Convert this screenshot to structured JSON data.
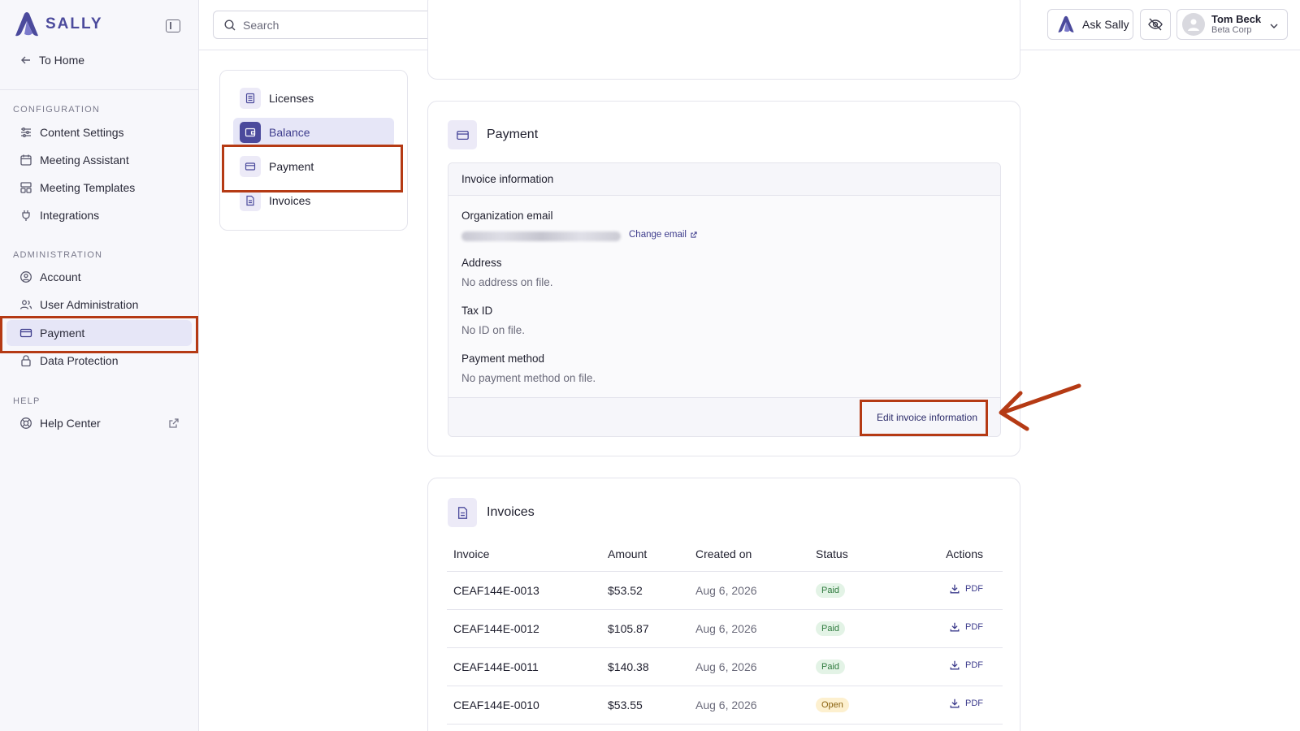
{
  "brand": {
    "name": "SALLY",
    "logo_icon": "sally-logo-icon"
  },
  "sidebar": {
    "back_label": "To Home",
    "sections": [
      {
        "title": "CONFIGURATION",
        "items": [
          {
            "label": "Content Settings",
            "icon": "sliders-icon"
          },
          {
            "label": "Meeting Assistant",
            "icon": "calendar-icon"
          },
          {
            "label": "Meeting Templates",
            "icon": "template-icon"
          },
          {
            "label": "Integrations",
            "icon": "plug-icon"
          }
        ]
      },
      {
        "title": "ADMINISTRATION",
        "items": [
          {
            "label": "Account",
            "icon": "user-circle-icon"
          },
          {
            "label": "User Administration",
            "icon": "users-icon"
          },
          {
            "label": "Payment",
            "icon": "credit-card-icon",
            "active": true
          },
          {
            "label": "Data Protection",
            "icon": "lock-icon"
          }
        ]
      },
      {
        "title": "HELP",
        "items": [
          {
            "label": "Help Center",
            "icon": "lifebuoy-icon",
            "external": true
          }
        ]
      }
    ]
  },
  "topbar": {
    "search_placeholder": "Search",
    "ask_label": "Ask Sally",
    "user": {
      "name": "Tom Beck",
      "org": "Beta Corp"
    }
  },
  "subnav": {
    "items": [
      {
        "label": "Licenses",
        "icon": "document-icon"
      },
      {
        "label": "Balance",
        "icon": "wallet-icon",
        "active": true
      },
      {
        "label": "Payment",
        "icon": "credit-card-icon"
      },
      {
        "label": "Invoices",
        "icon": "file-text-icon"
      }
    ]
  },
  "payment": {
    "title": "Payment",
    "box_title": "Invoice information",
    "org_email_label": "Organization email",
    "change_email_label": "Change email",
    "address_label": "Address",
    "address_value": "No address on file.",
    "tax_label": "Tax ID",
    "tax_value": "No ID on file.",
    "method_label": "Payment method",
    "method_value": "No payment method on file.",
    "edit_label": "Edit invoice information"
  },
  "invoices": {
    "title": "Invoices",
    "columns": [
      "Invoice",
      "Amount",
      "Created on",
      "Status",
      "Actions"
    ],
    "rows": [
      {
        "id": "CEAF144E-0013",
        "amount": "$53.52",
        "date": "Aug 6, 2026",
        "status": "Paid",
        "action": "PDF"
      },
      {
        "id": "CEAF144E-0012",
        "amount": "$105.87",
        "date": "Aug 6, 2026",
        "status": "Paid",
        "action": "PDF"
      },
      {
        "id": "CEAF144E-0011",
        "amount": "$140.38",
        "date": "Aug 6, 2026",
        "status": "Paid",
        "action": "PDF"
      },
      {
        "id": "CEAF144E-0010",
        "amount": "$53.55",
        "date": "Aug 6, 2026",
        "status": "Open",
        "action": "PDF"
      }
    ]
  },
  "colors": {
    "accent": "#4b4a9c",
    "annotation": "#b53a14",
    "active_bg": "#e6e6f7"
  }
}
